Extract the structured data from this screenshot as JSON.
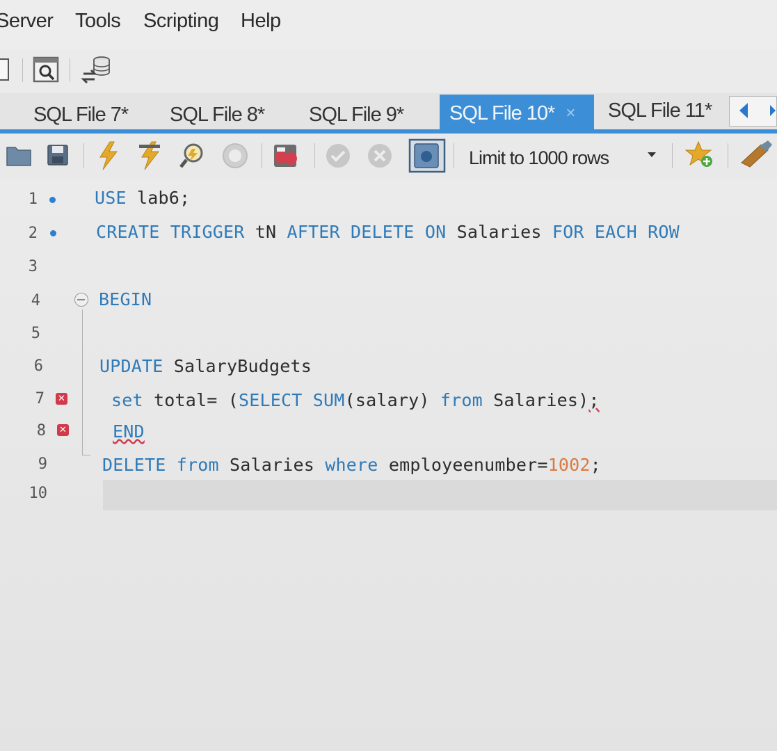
{
  "menu": [
    "Server",
    "Tools",
    "Scripting",
    "Help"
  ],
  "tabs": [
    {
      "label": "SQL File 7*",
      "active": false
    },
    {
      "label": "SQL File 8*",
      "active": false
    },
    {
      "label": "SQL File 9*",
      "active": false
    },
    {
      "label": "SQL File 10*",
      "active": true
    },
    {
      "label": "SQL File 11*",
      "active": false
    }
  ],
  "tab_close": "×",
  "editor_toolbar": {
    "limit_rows": "Limit to 1000 rows",
    "icons": [
      "open-folder-icon",
      "save-icon",
      "execute-icon",
      "execute-current-icon",
      "explain-icon",
      "stop-icon",
      "toggle-error-icon",
      "commit-icon",
      "rollback-icon",
      "autocommit-icon",
      "favorite-add-icon",
      "beautify-icon"
    ]
  },
  "main_toolbar": {
    "icons": [
      "panel-icon",
      "inspector-icon",
      "db-sync-icon"
    ]
  },
  "colors": {
    "accent": "#3c8fd6",
    "keyword": "#2f7ab8",
    "number": "#d97a43",
    "error": "#d23a4c"
  },
  "editor": {
    "line_numbers": [
      "1",
      "2",
      "3",
      "4",
      "5",
      "6",
      "7",
      "8",
      "9",
      "10"
    ],
    "lines": {
      "l1": {
        "kw1": "USE",
        "rest": " lab6;"
      },
      "l2": {
        "kw1": "CREATE TRIGGER",
        "id1": " tN ",
        "kw2": "AFTER DELETE ON",
        "id2": " Salaries ",
        "kw3": "FOR EACH ROW"
      },
      "l4": {
        "kw1": "BEGIN"
      },
      "l6": {
        "kw1": "UPDATE",
        "id1": " SalaryBudgets"
      },
      "l7": {
        "kw1": "set",
        "id1": " total= (",
        "kw2": "SELECT",
        "kw3": " SUM",
        "id2": "(salary) ",
        "kw4": "from",
        "id3": " Salaries)",
        "id4": ";"
      },
      "l8": {
        "kw1": "END"
      },
      "l9": {
        "kw1": "DELETE",
        "kw2": " from",
        "id1": " Salaries ",
        "kw3": "where",
        "id2": " employeenumber=",
        "num1": "1002",
        "id3": ";"
      }
    }
  }
}
